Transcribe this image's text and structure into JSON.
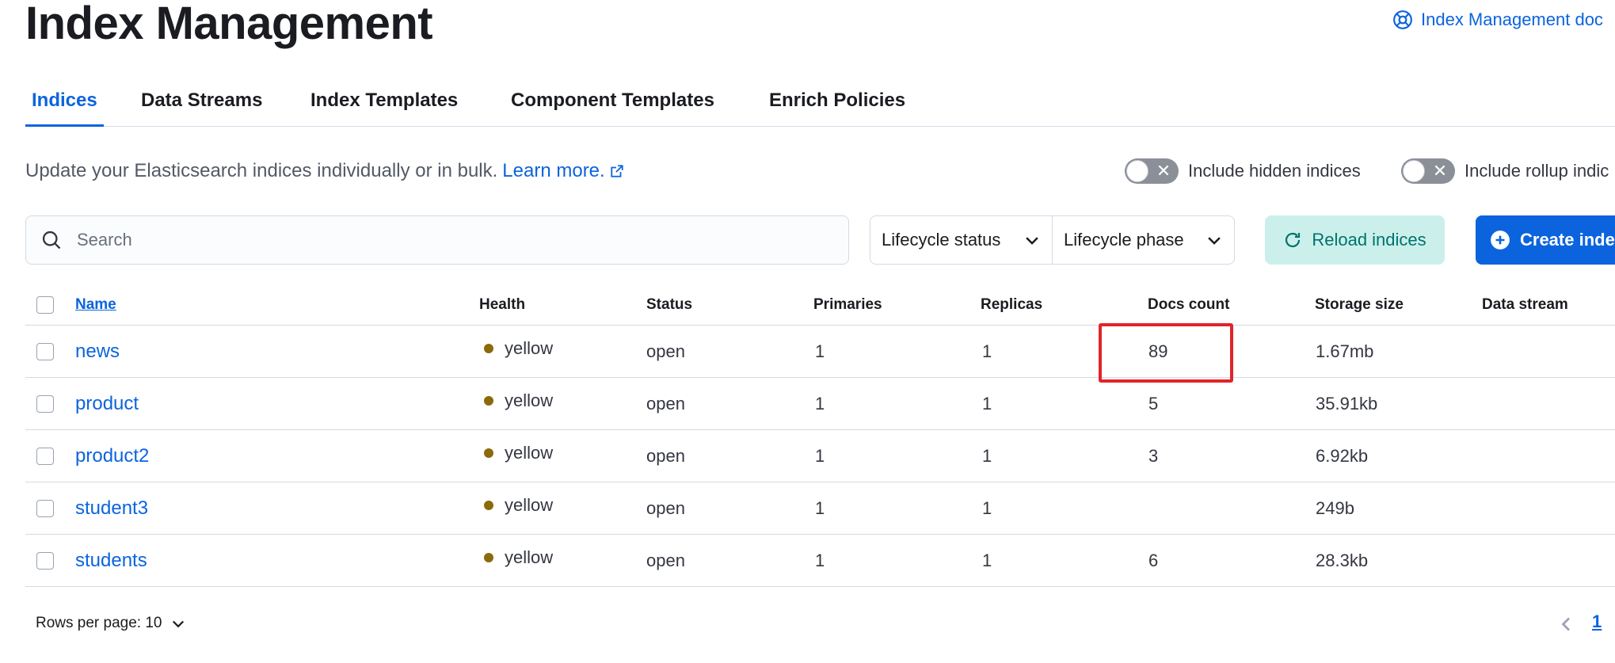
{
  "header": {
    "title": "Index Management",
    "docs_link": "Index Management doc"
  },
  "tabs": [
    {
      "label": "Indices",
      "active": true
    },
    {
      "label": "Data Streams",
      "active": false
    },
    {
      "label": "Index Templates",
      "active": false
    },
    {
      "label": "Component Templates",
      "active": false
    },
    {
      "label": "Enrich Policies",
      "active": false
    }
  ],
  "description": {
    "text": "Update your Elasticsearch indices individually or in bulk.",
    "link": "Learn more."
  },
  "toggles": {
    "hidden": "Include hidden indices",
    "rollup": "Include rollup indic"
  },
  "search": {
    "placeholder": "Search",
    "value": ""
  },
  "filters": {
    "lifecycle_status": "Lifecycle status",
    "lifecycle_phase": "Lifecycle phase"
  },
  "buttons": {
    "reload": "Reload indices",
    "create": "Create inde"
  },
  "table": {
    "columns": {
      "name": "Name",
      "health": "Health",
      "status": "Status",
      "primaries": "Primaries",
      "replicas": "Replicas",
      "docs_count": "Docs count",
      "storage_size": "Storage size",
      "data_stream": "Data stream"
    },
    "rows": [
      {
        "name": "news",
        "health": "yellow",
        "status": "open",
        "primaries": "1",
        "replicas": "1",
        "docs_count": "89",
        "storage_size": "1.67mb",
        "data_stream": ""
      },
      {
        "name": "product",
        "health": "yellow",
        "status": "open",
        "primaries": "1",
        "replicas": "1",
        "docs_count": "5",
        "storage_size": "35.91kb",
        "data_stream": ""
      },
      {
        "name": "product2",
        "health": "yellow",
        "status": "open",
        "primaries": "1",
        "replicas": "1",
        "docs_count": "3",
        "storage_size": "6.92kb",
        "data_stream": ""
      },
      {
        "name": "student3",
        "health": "yellow",
        "status": "open",
        "primaries": "1",
        "replicas": "1",
        "docs_count": "",
        "storage_size": "249b",
        "data_stream": ""
      },
      {
        "name": "students",
        "health": "yellow",
        "status": "open",
        "primaries": "1",
        "replicas": "1",
        "docs_count": "6",
        "storage_size": "28.3kb",
        "data_stream": ""
      }
    ]
  },
  "pagination": {
    "rows_per_page": "Rows per page: 10",
    "current_page": "1"
  },
  "colors": {
    "accent": "#0b64dd",
    "health_yellow": "#8a6a0a",
    "highlight": "#e0252a",
    "reload_bg": "#cbf0ec"
  },
  "icons": [
    "help-lifebuoy-icon",
    "external-link-icon",
    "cross-icon",
    "search-icon",
    "chevron-down-icon",
    "refresh-icon",
    "plus-circle-icon",
    "chevron-left-icon"
  ]
}
